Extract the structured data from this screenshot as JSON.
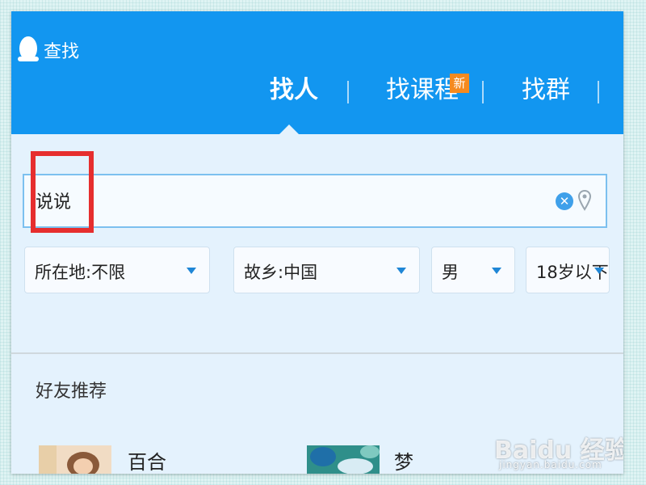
{
  "window": {
    "title": "查找"
  },
  "tabs": [
    {
      "label": "找人",
      "active": true
    },
    {
      "label": "找课程",
      "badge": "新"
    },
    {
      "label": "找群"
    }
  ],
  "search": {
    "value": "说说"
  },
  "filters": [
    {
      "label": "所在地:不限"
    },
    {
      "label": "故乡:中国"
    },
    {
      "label": "男"
    },
    {
      "label": "18岁以下"
    }
  ],
  "recommend": {
    "title": "好友推荐",
    "friends": [
      {
        "name": "百合"
      },
      {
        "name": "梦"
      }
    ]
  },
  "watermark": {
    "text": "Baidu 经验",
    "sub": "jingyan.baidu.com"
  },
  "colors": {
    "header": "#1296f0",
    "body": "#e4f2fd",
    "highlight": "#e62e2e",
    "badge": "#f58a1f"
  }
}
